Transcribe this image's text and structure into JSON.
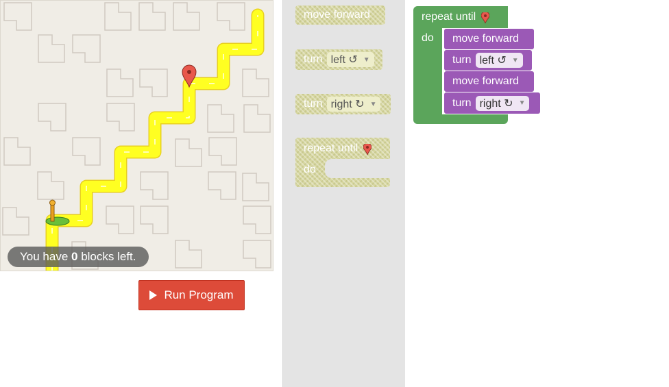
{
  "maze": {
    "capacity": {
      "prefix": "You have ",
      "count": "0",
      "suffix": " blocks left."
    },
    "run_button": "Run Program"
  },
  "toolbox": {
    "move_forward": "move forward",
    "turn_left": {
      "label": "turn",
      "dir": "left ↺"
    },
    "turn_right": {
      "label": "turn",
      "dir": "right ↻"
    },
    "repeat_until": {
      "label": "repeat until",
      "do": "do"
    }
  },
  "workspace": {
    "repeat_until": "repeat until",
    "do": "do",
    "statements": [
      {
        "label": "move forward"
      },
      {
        "label": "turn",
        "dir": "left ↺"
      },
      {
        "label": "move forward"
      },
      {
        "label": "turn",
        "dir": "right ↻"
      }
    ]
  },
  "colors": {
    "path": "#ffff33",
    "run": "#dd4b39",
    "loop": "#5ba55b",
    "action": "#9b59b6"
  },
  "icons": {
    "goal": "map-marker-icon",
    "start": "pegman-icon",
    "play": "play-icon"
  }
}
